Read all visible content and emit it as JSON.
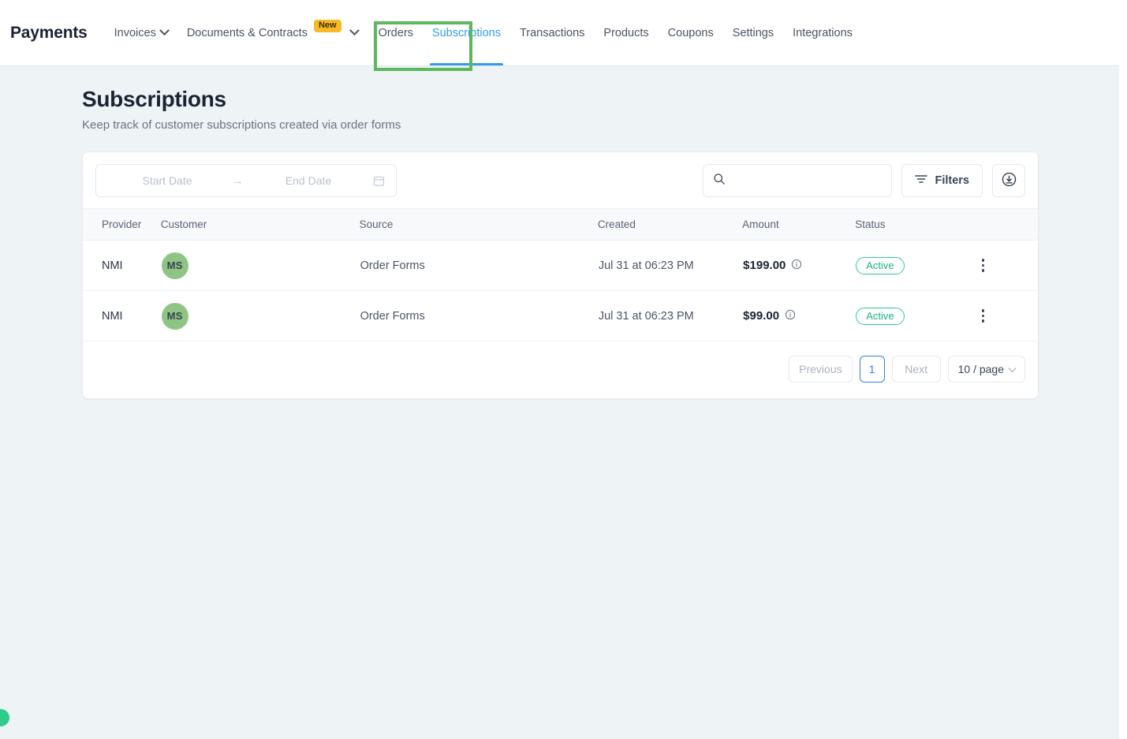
{
  "nav": {
    "brand": "Payments",
    "items": [
      {
        "label": "Invoices",
        "has_chevron": true,
        "icon": "chevron-down-icon",
        "active": false
      },
      {
        "label": "Documents & Contracts",
        "badge": "New",
        "active": false
      },
      {
        "label": "Orders",
        "active": false
      },
      {
        "label": "Subscriptions",
        "active": true
      },
      {
        "label": "Transactions",
        "active": false
      },
      {
        "label": "Products",
        "active": false
      },
      {
        "label": "Coupons",
        "active": false
      },
      {
        "label": "Settings",
        "active": false
      },
      {
        "label": "Integrations",
        "active": false
      }
    ]
  },
  "page": {
    "title": "Subscriptions",
    "subtitle": "Keep track of customer subscriptions created via order forms"
  },
  "toolbar": {
    "date_range": {
      "start_placeholder": "Start Date",
      "end_placeholder": "End Date",
      "start_value": "",
      "end_value": "",
      "separator": "→",
      "calendar_icon": "calendar-icon"
    },
    "search": {
      "value": "",
      "placeholder": "",
      "icon": "search-icon"
    },
    "filters_label": "Filters",
    "filters_icon": "filter-icon",
    "export_icon": "download-icon"
  },
  "table": {
    "columns": [
      "Provider",
      "Customer",
      "Source",
      "Created",
      "Amount",
      "Status"
    ],
    "rows": [
      {
        "provider": "NMI",
        "customer_initials": "MS",
        "source": "Order Forms",
        "created": "Jul 31 at 06:23 PM",
        "amount": "$199.00",
        "amount_info_icon": "info-icon",
        "status": "Active"
      },
      {
        "provider": "NMI",
        "customer_initials": "MS",
        "source": "Order Forms",
        "created": "Jul 31 at 06:23 PM",
        "amount": "$99.00",
        "amount_info_icon": "info-icon",
        "status": "Active"
      }
    ]
  },
  "pagination": {
    "previous_label": "Previous",
    "current_page": "1",
    "next_label": "Next",
    "per_page_label": "10 / page"
  },
  "colors": {
    "page_background": "#eef3f6",
    "accent_blue": "#2f9cf4",
    "status_green": "#17b877",
    "badge_yellow": "#f7b924",
    "avatar_green": "#8fc584",
    "highlight_green": "#5cb85c"
  }
}
